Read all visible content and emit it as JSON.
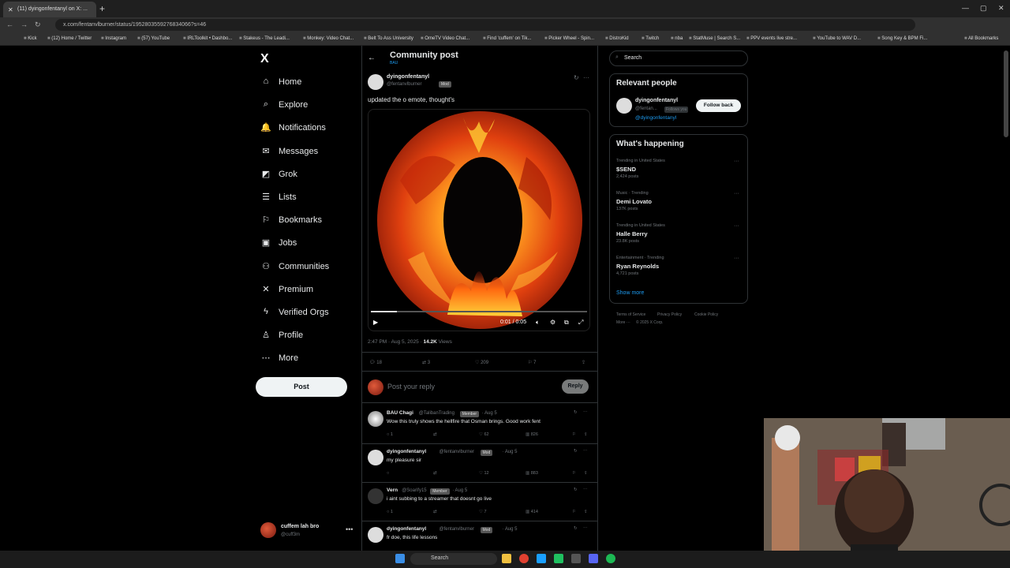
{
  "browser": {
    "tab_title": "(11) dyingonfentanyl on X: ...",
    "url": "x.com/fentanvlburner/status/1952803559276834066?s=46",
    "bookmarks": [
      "Kick",
      "(12) Home / Twitter",
      "Instagram",
      "(57) YouTube",
      "IRLToolkit • Dashbo...",
      "Stakeus - The Leadi...",
      "Monkey: Video Chat...",
      "Belt To Ass University",
      "OmeTV Video Chat...",
      "Find 'cuffem' on Tik...",
      "Picker Wheel - Spin...",
      "DistroKid",
      "Twitch",
      "nba",
      "StatMuse | Search S...",
      "PPV events live stre...",
      "YouTube to WAV D...",
      "Song Key & BPM Fi...",
      "All Bookmarks"
    ]
  },
  "sidebar": {
    "logo": "X",
    "items": [
      {
        "label": "Home",
        "icon": "home-icon",
        "glyph": "⌂"
      },
      {
        "label": "Explore",
        "icon": "search-icon",
        "glyph": "⌕"
      },
      {
        "label": "Notifications",
        "icon": "bell-icon",
        "glyph": "🔔"
      },
      {
        "label": "Messages",
        "icon": "mail-icon",
        "glyph": "✉"
      },
      {
        "label": "Grok",
        "icon": "grok-icon",
        "glyph": "◩"
      },
      {
        "label": "Lists",
        "icon": "list-icon",
        "glyph": "☰"
      },
      {
        "label": "Bookmarks",
        "icon": "bookmark-icon",
        "glyph": "⚐"
      },
      {
        "label": "Jobs",
        "icon": "briefcase-icon",
        "glyph": "▣"
      },
      {
        "label": "Communities",
        "icon": "people-icon",
        "glyph": "⚇"
      },
      {
        "label": "Premium",
        "icon": "x-premium-icon",
        "glyph": "✕"
      },
      {
        "label": "Verified Orgs",
        "icon": "lightning-icon",
        "glyph": "ϟ"
      },
      {
        "label": "Profile",
        "icon": "person-icon",
        "glyph": "♙"
      },
      {
        "label": "More",
        "icon": "more-circle-icon",
        "glyph": "⋯"
      }
    ],
    "post_button": "Post",
    "account": {
      "name": "cuffem lah bro",
      "handle": "@cuff3m"
    }
  },
  "main": {
    "title": "Community post",
    "community": "BAU",
    "post": {
      "author": "dyingonfentanyl",
      "handle": "@fentanvlburner",
      "badge": "Mod",
      "text": "updated the o emote, thought's",
      "video_time": "0:01 / 0:05",
      "timestamp": "2:47 PM · Aug 5, 2025 · ",
      "views_count": "14.2K",
      "views_label": " Views",
      "replies": "18",
      "reposts": "3",
      "likes": "209",
      "bookmarks": "7",
      "progress": 0.12
    },
    "reply_placeholder": "Post your reply",
    "reply_button": "Reply",
    "comments": [
      {
        "name": "BAU Chagi",
        "handle": "@TalibanTrading",
        "badge": "Member",
        "date": "· Aug 5",
        "text": "Wow this truly shows the hellfire that Osman brings. Good work fent",
        "replies": "1",
        "reposts": "",
        "likes": "62",
        "views": "826"
      },
      {
        "name": "dyingonfentanyl",
        "handle": "@fentanvlburner",
        "badge": "Mod",
        "date": "· Aug 5",
        "text": "my pleasure sir",
        "replies": "",
        "reposts": "",
        "likes": "12",
        "views": "883"
      },
      {
        "name": "Vern",
        "handle": "@Soarify15",
        "badge": "Member",
        "date": "· Aug 5",
        "text": "i aint subbing to a streamer that doesnt go live",
        "replies": "1",
        "reposts": "",
        "likes": "7",
        "views": "414"
      },
      {
        "name": "dyingonfentanyl",
        "handle": "@fentanvlburner",
        "badge": "Mod",
        "date": "· Aug 5",
        "text": "fr doe, this life lessons",
        "replies": "",
        "reposts": "",
        "likes": "",
        "views": ""
      }
    ]
  },
  "right": {
    "search_placeholder": "Search",
    "relevant_title": "Relevant people",
    "relevant": {
      "name": "dyingonfentanyl",
      "handle": "@fentan...",
      "follows_you": "Follows you",
      "bio": "@dyingonfentanyl",
      "button": "Follow back"
    },
    "happening_title": "What's happening",
    "trends": [
      {
        "category": "Trending in United States",
        "name": "$SEND",
        "count": "2,424 posts"
      },
      {
        "category": "Music · Trending",
        "name": "Demi Lovato",
        "count": "137K posts"
      },
      {
        "category": "Trending in United States",
        "name": "Halle Berry",
        "count": "23.8K posts"
      },
      {
        "category": "Entertainment · Trending",
        "name": "Ryan Reynolds",
        "count": "4,721 posts"
      }
    ],
    "show_more": "Show more",
    "footer": [
      "Terms of Service",
      "Privacy Policy",
      "Cookie Policy",
      "More ···",
      "© 2025 X Corp."
    ]
  },
  "taskbar": {
    "search": "Search"
  },
  "colors": {
    "accent": "#1d9bf0",
    "bg": "#000000",
    "muted": "#71767b",
    "text": "#e7e9ea"
  }
}
